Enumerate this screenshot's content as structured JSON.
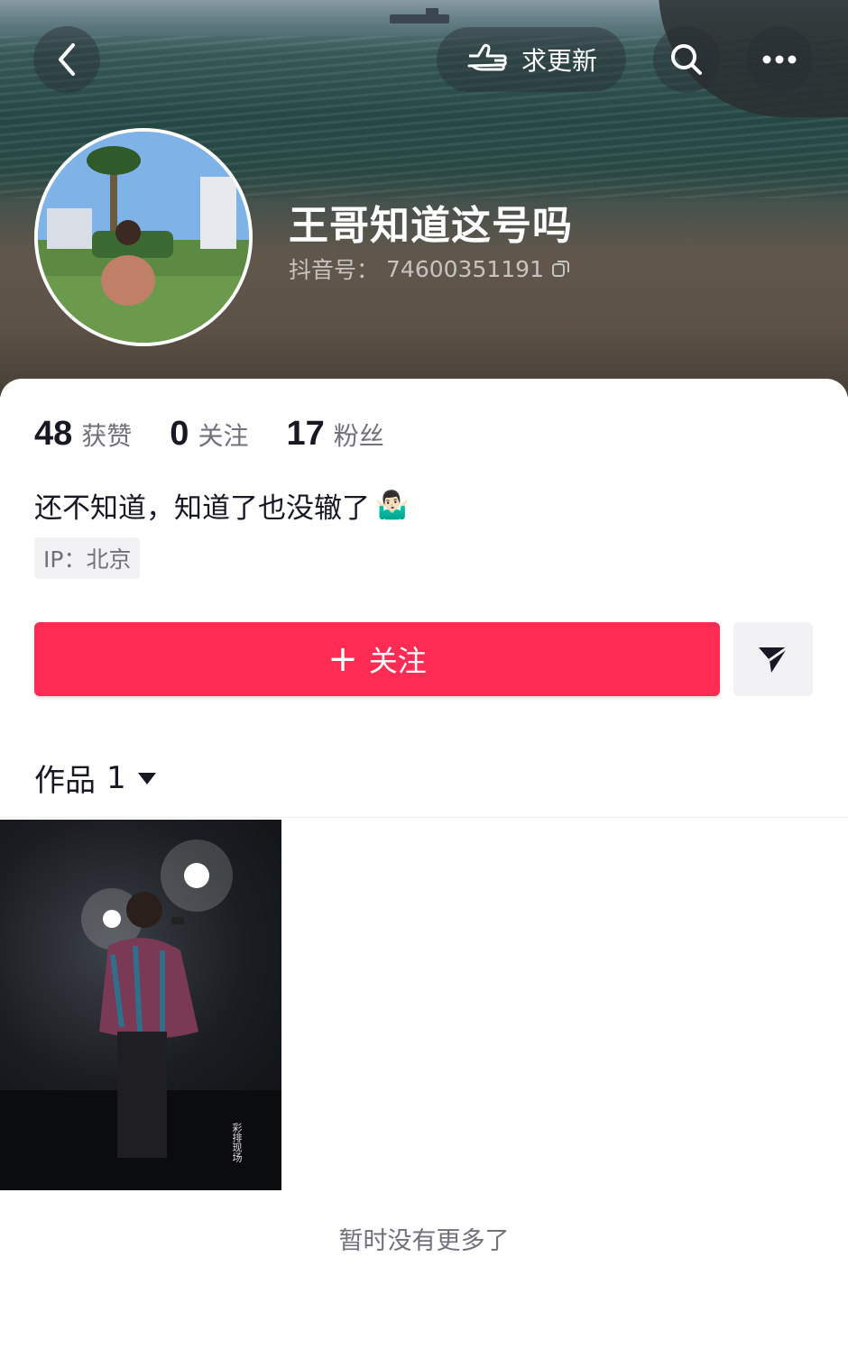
{
  "header": {
    "request_update_label": "求更新",
    "username": "王哥知道这号吗",
    "douyin_id_label": "抖音号：",
    "douyin_id": "74600351191"
  },
  "stats": [
    {
      "value": "48",
      "label": "获赞"
    },
    {
      "value": "0",
      "label": "关注"
    },
    {
      "value": "17",
      "label": "粉丝"
    }
  ],
  "bio": "还不知道，知道了也没辙了",
  "bio_emoji": "🤷🏻‍♂️",
  "ip": "IP：北京",
  "follow_button": {
    "icon": "+",
    "label": "关注"
  },
  "works_tab": {
    "label": "作品",
    "count": "1"
  },
  "work_thumb_caption": "彩排现场",
  "no_more": "暂时没有更多了",
  "colors": {
    "accent": "#fe2c55",
    "text": "#161823",
    "secondary": "#70717a"
  }
}
